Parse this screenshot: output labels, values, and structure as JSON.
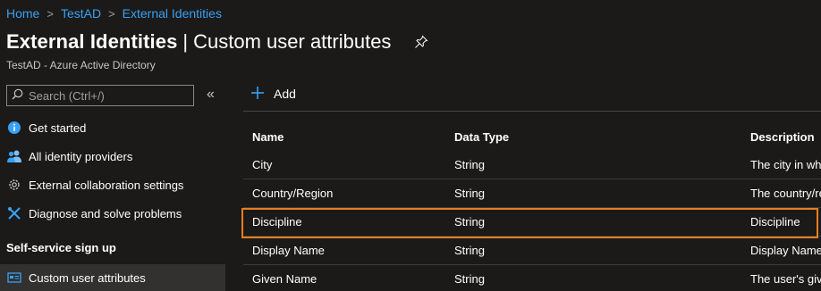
{
  "breadcrumb": {
    "items": [
      "Home",
      "TestAD",
      "External Identities"
    ],
    "separator": ">"
  },
  "header": {
    "title_main": "External Identities",
    "title_bar": "|",
    "title_sub": "Custom user attributes",
    "subtitle": "TestAD - Azure Active Directory"
  },
  "sidebar": {
    "search_placeholder": "Search (Ctrl+/)",
    "collapse_glyph": "«",
    "items": [
      {
        "label": "Get started",
        "icon": "info-icon"
      },
      {
        "label": "All identity providers",
        "icon": "users-icon"
      },
      {
        "label": "External collaboration settings",
        "icon": "gear-icon"
      },
      {
        "label": "Diagnose and solve problems",
        "icon": "wrench-icon"
      }
    ],
    "section_label": "Self-service sign up",
    "section_items": [
      {
        "label": "Custom user attributes",
        "icon": "card-icon",
        "active": true
      }
    ]
  },
  "toolbar": {
    "add_label": "Add"
  },
  "table": {
    "columns": [
      "Name",
      "Data Type",
      "Description"
    ],
    "rows": [
      {
        "name": "City",
        "type": "String",
        "desc": "The city in wh"
      },
      {
        "name": "Country/Region",
        "type": "String",
        "desc": "The country/re"
      },
      {
        "name": "Discipline",
        "type": "String",
        "desc": "Discipline",
        "highlighted": true
      },
      {
        "name": "Display Name",
        "type": "String",
        "desc": "Display Name"
      },
      {
        "name": "Given Name",
        "type": "String",
        "desc": "The user's give"
      }
    ]
  },
  "colors": {
    "accent": "#3aa0f3",
    "highlight": "#e67e22",
    "background": "#1b1a19"
  }
}
